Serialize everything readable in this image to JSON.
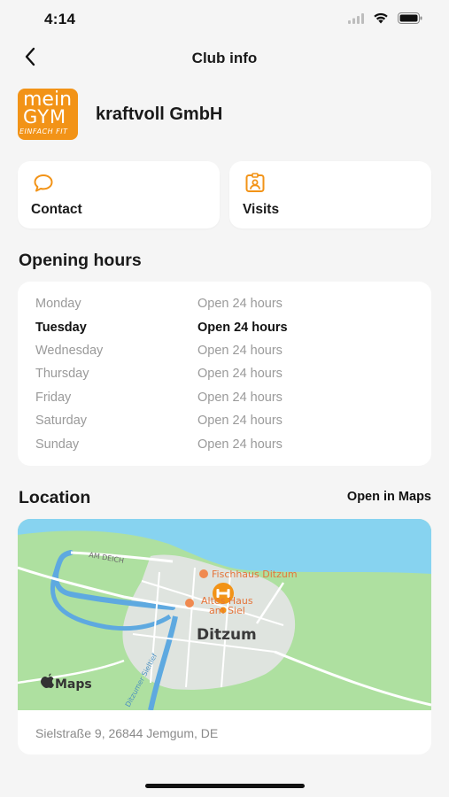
{
  "status_bar": {
    "time": "4:14"
  },
  "nav": {
    "title": "Club info"
  },
  "club": {
    "name": "kraftvoll GmbH",
    "logo_line1": "mein",
    "logo_line2": "GYM",
    "logo_line3": "EINFACH FIT",
    "logo_color": "#f29317"
  },
  "actions": {
    "contact_label": "Contact",
    "visits_label": "Visits",
    "icon_color": "#f29317"
  },
  "opening_hours": {
    "title": "Opening hours",
    "days": [
      {
        "day": "Monday",
        "hours": "Open 24 hours",
        "today": false
      },
      {
        "day": "Tuesday",
        "hours": "Open 24 hours",
        "today": true
      },
      {
        "day": "Wednesday",
        "hours": "Open 24 hours",
        "today": false
      },
      {
        "day": "Thursday",
        "hours": "Open 24 hours",
        "today": false
      },
      {
        "day": "Friday",
        "hours": "Open 24 hours",
        "today": false
      },
      {
        "day": "Saturday",
        "hours": "Open 24 hours",
        "today": false
      },
      {
        "day": "Sunday",
        "hours": "Open 24 hours",
        "today": false
      }
    ]
  },
  "location": {
    "title": "Location",
    "open_in_maps": "Open in Maps",
    "address": "Sielstraße 9, 26844 Jemgum, DE",
    "map": {
      "place_label": "Ditzum",
      "road_label": "AM DEICH",
      "poi_1": "Fischhaus Ditzum",
      "poi_2_line1": "Altes Haus",
      "poi_2_line2": "am Siel",
      "canal_label": "Ditzumer Sieltief",
      "brand": "Maps"
    }
  }
}
